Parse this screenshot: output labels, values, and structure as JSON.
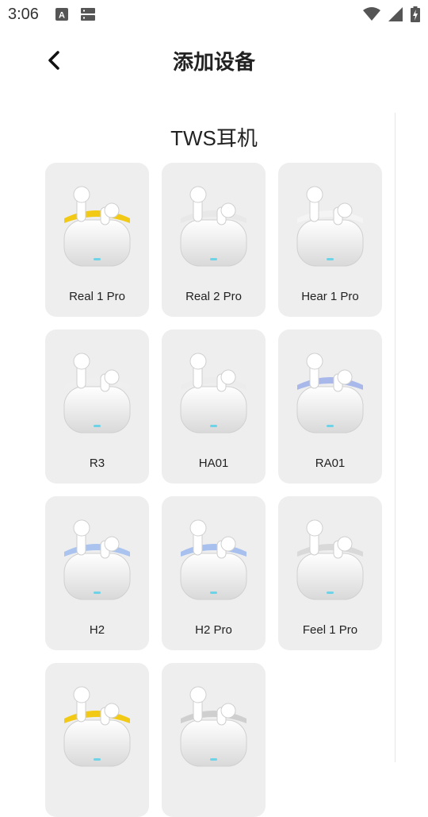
{
  "status_bar": {
    "time": "3:06"
  },
  "header": {
    "title": "添加设备"
  },
  "section": {
    "title": "TWS耳机"
  },
  "devices": [
    {
      "name": "Real 1 Pro",
      "accent": "#f2c914"
    },
    {
      "name": "Real 2 Pro",
      "accent": "#e8e8e8"
    },
    {
      "name": "Hear 1 Pro",
      "accent": "#f4f4f4"
    },
    {
      "name": "R3",
      "accent": "#efefef"
    },
    {
      "name": "HA01",
      "accent": "#ececec"
    },
    {
      "name": "RA01",
      "accent": "#a9b8ea"
    },
    {
      "name": "H2",
      "accent": "#aac4ef"
    },
    {
      "name": "H2 Pro",
      "accent": "#a8c0ee"
    },
    {
      "name": "Feel 1 Pro",
      "accent": "#d9d9d9"
    },
    {
      "name": "",
      "accent": "#f2c914"
    },
    {
      "name": "",
      "accent": "#cfcfcf"
    }
  ]
}
